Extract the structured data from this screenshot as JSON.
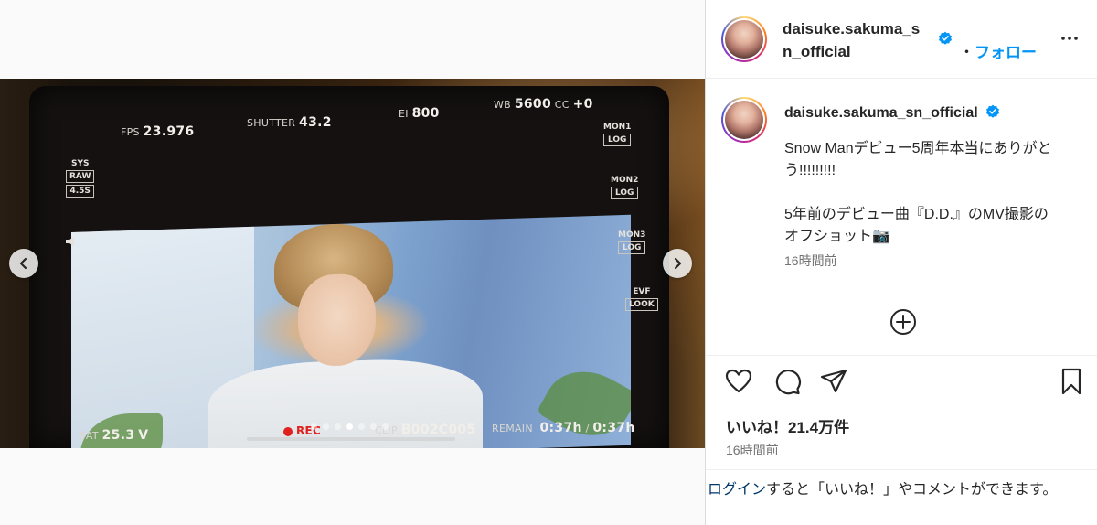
{
  "post": {
    "username": "daisuke.sakuma_sn_official",
    "header_username_line1": "daisuke.sakuma_s",
    "header_username_line2": "n_official",
    "separator": "・",
    "follow_label": "フォロー",
    "caption_line1": "Snow Manデビュー5周年本当にありがとう!!!!!!!!!",
    "caption_line2": "5年前のデビュー曲『D.D.』のMV撮影のオフショット📷",
    "caption_time": "16時間前",
    "likes": "いいね！21.4万件",
    "post_time": "16時間前",
    "login_link": "ログイン",
    "login_rest": "すると「いいね！」やコメントができます。"
  },
  "monitor_hud": {
    "fps_label": "FPS",
    "fps_value": "23.976",
    "shutter_label": "SHUTTER",
    "shutter_value": "43.2",
    "ei_label": "EI",
    "ei_value": "800",
    "wb_label": "WB",
    "wb_value": "5600",
    "cc_label": "CC",
    "cc_value": "+0",
    "sys_label": "SYS",
    "sys_raw": "RAW",
    "sys_res": "4.5S",
    "mon1_label": "MON1",
    "mon1_value": "LOG",
    "mon2_label": "MON2",
    "mon2_value": "LOG",
    "mon3_label": "MON3",
    "mon3_value": "LOG",
    "evf_label": "EVF",
    "evf_value": "LOOK",
    "bat_label": "BAT",
    "bat_value": "25.3",
    "bat_unit": "V",
    "rec_label": "REC",
    "clip_label": "CLIP",
    "clip_value": "B002C005",
    "remain_label": "REMAIN",
    "remain_value1": "0:37h",
    "remain_sep": "/",
    "remain_value2": "0:37h"
  },
  "carousel": {
    "total": 7,
    "active_index": 3
  },
  "colors": {
    "accent": "#0095f6",
    "link": "#00376b",
    "verified": "#0095f6"
  },
  "icons": [
    "chevron-left-icon",
    "chevron-right-icon",
    "verified-icon",
    "more-icon",
    "plus-circle-icon",
    "heart-icon",
    "comment-icon",
    "share-icon",
    "bookmark-icon"
  ]
}
